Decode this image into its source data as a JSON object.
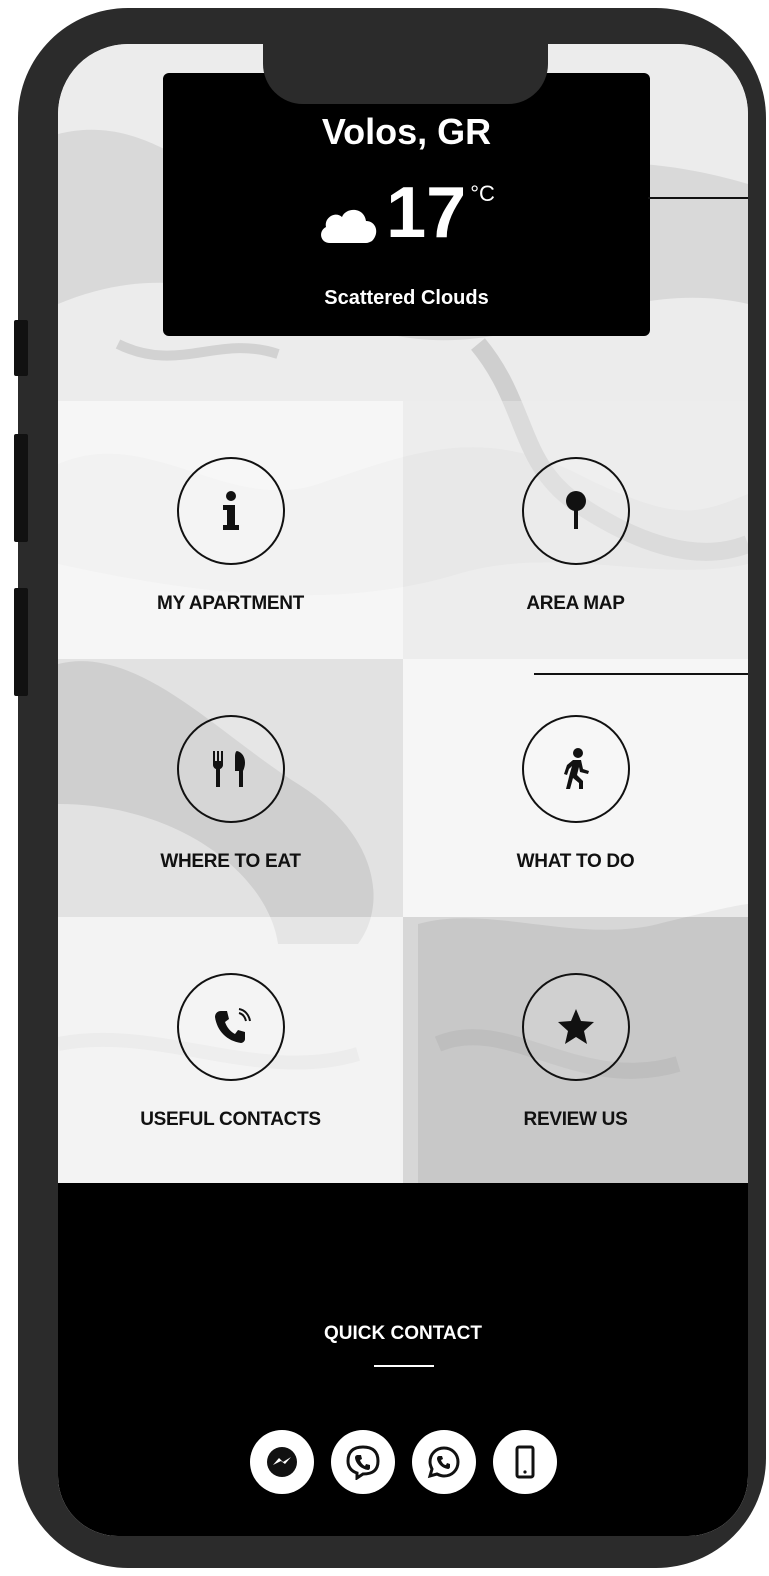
{
  "weather": {
    "city": "Volos, GR",
    "temperature": "17",
    "unit": "°C",
    "description": "Scattered Clouds",
    "icon": "cloud-icon"
  },
  "menu": {
    "items": [
      {
        "label": "MY APARTMENT",
        "icon": "info-icon"
      },
      {
        "label": "AREA MAP",
        "icon": "map-pin-icon"
      },
      {
        "label": "WHERE TO EAT",
        "icon": "fork-knife-icon"
      },
      {
        "label": "WHAT TO DO",
        "icon": "walking-person-icon"
      },
      {
        "label": "USEFUL CONTACTS",
        "icon": "phone-icon"
      },
      {
        "label": "REVIEW US",
        "icon": "star-icon"
      }
    ]
  },
  "quick_contact": {
    "title": "QUICK CONTACT",
    "icons": [
      "messenger-icon",
      "viber-icon",
      "whatsapp-icon",
      "mobile-phone-icon"
    ]
  },
  "colors": {
    "frame": "#2b2b2b",
    "panel": "#000000",
    "text_light": "#ffffff",
    "text_dark": "#111111"
  }
}
